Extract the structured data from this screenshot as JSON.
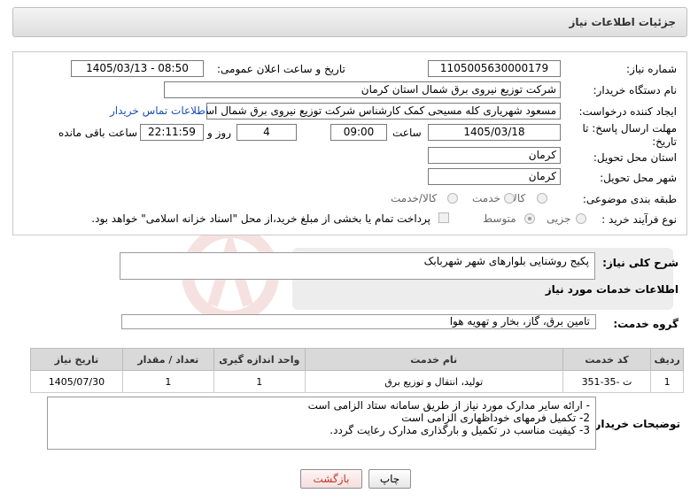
{
  "header": {
    "title": "جزئیات اطلاعات نیاز"
  },
  "form": {
    "need_number": {
      "label": "شماره نیاز:",
      "value": "1105005630000179"
    },
    "announce_datetime": {
      "label": "تاریخ و ساعت اعلان عمومی:",
      "value": "1405/03/13 - 08:50"
    },
    "buyer_org": {
      "label": "نام دستگاه خریدار:",
      "value": "شرکت توزیع نیروی برق شمال استان کرمان"
    },
    "creator": {
      "label": "ایجاد کننده درخواست:",
      "value": "مسعود شهریاری کله مسیحی کمک کارشناس شرکت توزیع نیروی برق شمال استان کرمان",
      "contact_link": "اطلاعات تماس خریدار"
    },
    "deadline": {
      "label": "مهلت ارسال پاسخ: تا تاریخ:",
      "date": "1405/03/18",
      "time_label": "ساعت",
      "time": "09:00",
      "days": "4",
      "days_label": "روز و",
      "remaining": "22:11:59",
      "remaining_label": "ساعت باقی مانده"
    },
    "delivery_province": {
      "label": "استان محل تحویل:",
      "value": "کرمان"
    },
    "delivery_city": {
      "label": "شهر محل تحویل:",
      "value": "کرمان"
    },
    "category": {
      "label": "طبقه بندی موضوعی:",
      "options": [
        "کالا",
        "خدمت",
        "کالا/خدمت"
      ],
      "selected": ""
    },
    "process_type": {
      "label": "نوع فرآیند خرید :",
      "options": [
        "جزیی",
        "متوسط"
      ],
      "selected": "متوسط",
      "payment_note": "پرداخت تمام یا بخشی از مبلغ خرید،از محل \"اسناد خزانه اسلامی\" خواهد بود."
    }
  },
  "summary": {
    "label": "شرح کلی نیاز:",
    "value": "پکیج روشنایی بلوارهای شهر شهربابک"
  },
  "services_section": {
    "title": "اطلاعات خدمات مورد نیاز"
  },
  "service_group": {
    "label": "گروه خدمت:",
    "value": "تامین برق، گاز، بخار و تهویه هوا"
  },
  "table": {
    "headers": [
      "ردیف",
      "کد خدمت",
      "نام خدمت",
      "واحد اندازه گیری",
      "تعداد / مقدار",
      "تاریخ نیاز"
    ],
    "rows": [
      [
        "1",
        "ت -35-351",
        "تولید، انتقال و توزیع برق",
        "1",
        "1",
        "1405/07/30"
      ]
    ]
  },
  "buyer_notes": {
    "label": "توضیحات خریدار:",
    "lines": [
      "- ارائه سایر مدارک مورد نیاز از طریق سامانه ستاد الزامی است",
      "2- تکمیل فرمهای خوداظهاری الزامی است",
      "3- کیفیت مناسب در تکمیل و بارگذاری مدارک رعایت گردد."
    ]
  },
  "buttons": {
    "print": "چاپ",
    "back": "بازگشت"
  },
  "colors": {
    "link": "#1a4fb5",
    "back_button_text": "#c0392b",
    "table_header_bg": "#d9d9d9"
  }
}
